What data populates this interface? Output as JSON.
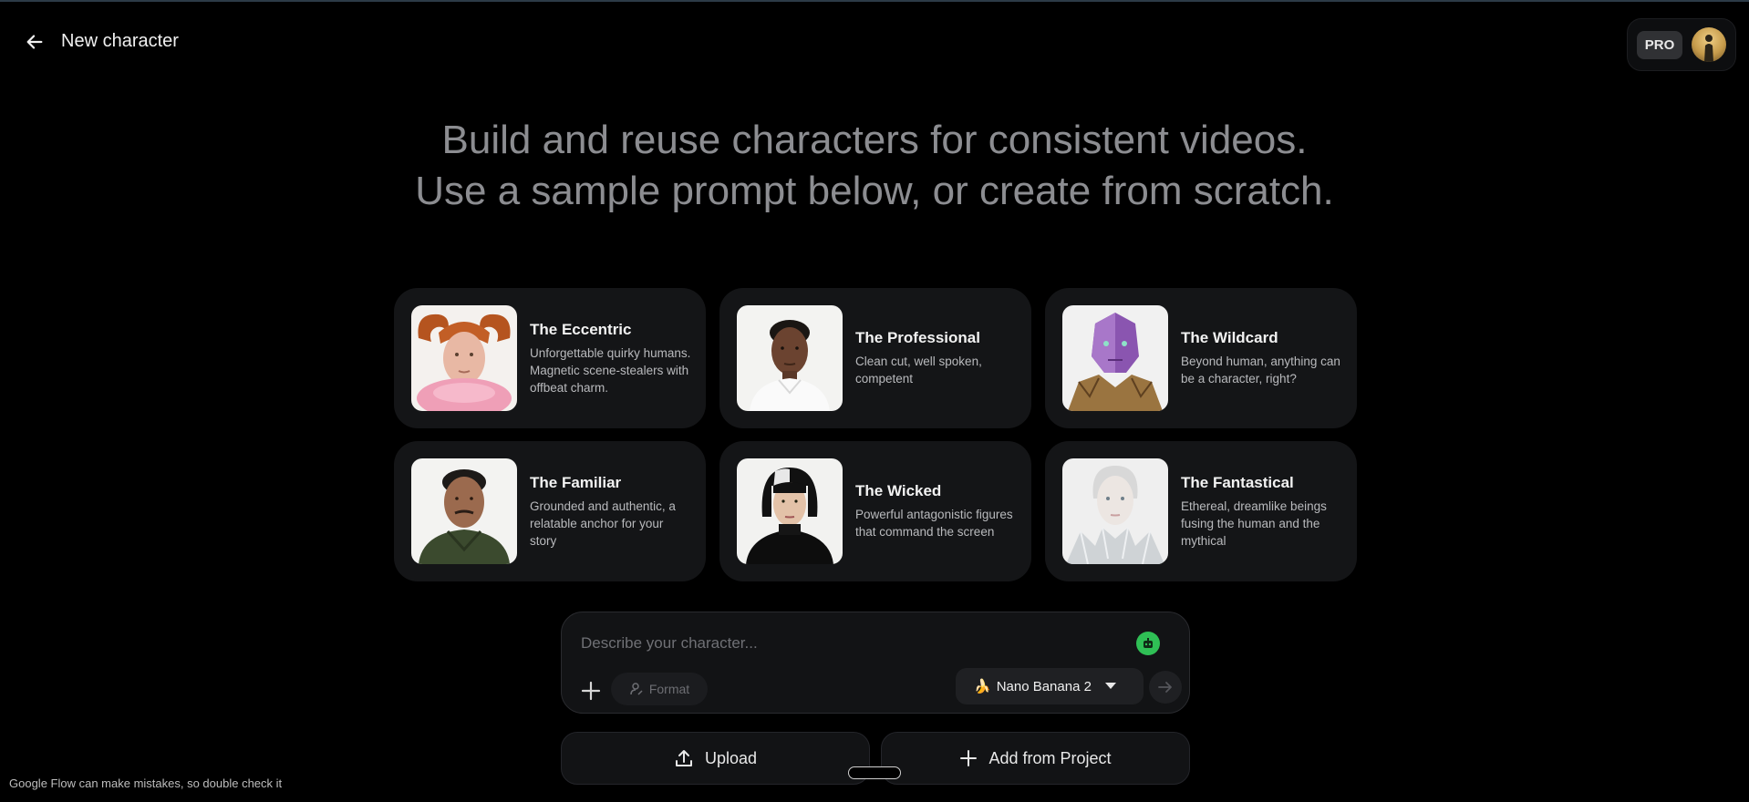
{
  "header": {
    "back_icon": "arrow-left-icon",
    "title": "New character",
    "pro_badge": "PRO"
  },
  "hero": {
    "line1": "Build and reuse characters for consistent videos.",
    "line2": "Use a sample prompt below, or create from scratch."
  },
  "cards": [
    {
      "name": "The Eccentric",
      "desc": "Unforgettable quirky humans. Magnetic scene-stealers with offbeat charm."
    },
    {
      "name": "The Professional",
      "desc": "Clean cut, well spoken, competent"
    },
    {
      "name": "The Wildcard",
      "desc": "Beyond human, anything can be a character, right?"
    },
    {
      "name": "The Familiar",
      "desc": "Grounded and authentic, a relatable anchor for your story"
    },
    {
      "name": "The Wicked",
      "desc": "Powerful antagonistic figures that command the screen"
    },
    {
      "name": "The Fantastical",
      "desc": "Ethereal, dreamlike beings fusing the human and the mythical"
    }
  ],
  "prompt": {
    "placeholder": "Describe your character...",
    "format_label": "Format",
    "model_emoji": "🍌",
    "model_label": "Nano Banana 2",
    "accent": "#2fbf55"
  },
  "actions": {
    "upload_label": "Upload",
    "add_from_project_label": "Add from Project"
  },
  "footer": {
    "disclaimer": "Google Flow can make mistakes, so double check it"
  }
}
